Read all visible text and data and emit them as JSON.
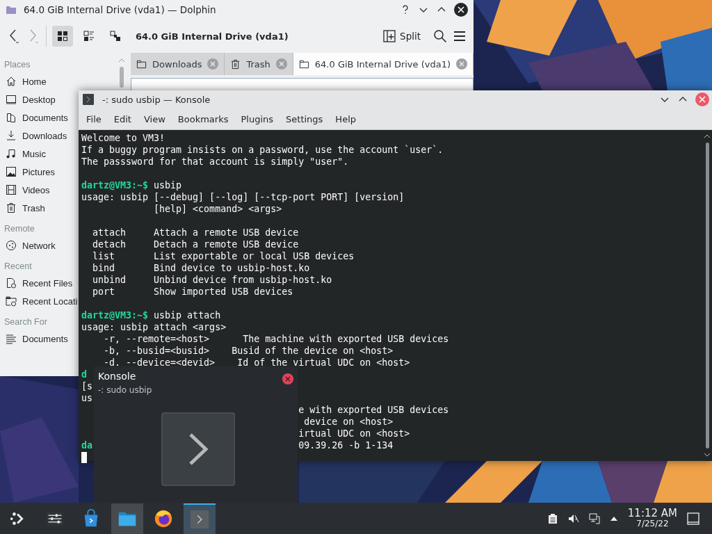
{
  "dolphin": {
    "title": "64.0 GiB Internal Drive (vda1) — Dolphin",
    "location": "64.0 GiB Internal Drive (vda1)",
    "split_label": "Split",
    "tabs": [
      {
        "label": "Downloads",
        "selected": false
      },
      {
        "label": "Trash",
        "selected": false
      },
      {
        "label": "64.0 GiB Internal Drive (vda1)",
        "selected": true
      }
    ],
    "sidebar": [
      {
        "heading": "Places",
        "items": [
          {
            "kind": "home",
            "label": "Home"
          },
          {
            "kind": "desktop",
            "label": "Desktop"
          },
          {
            "kind": "documents",
            "label": "Documents"
          },
          {
            "kind": "downloads",
            "label": "Downloads"
          },
          {
            "kind": "music",
            "label": "Music"
          },
          {
            "kind": "pictures",
            "label": "Pictures"
          },
          {
            "kind": "videos",
            "label": "Videos"
          },
          {
            "kind": "trash",
            "label": "Trash"
          }
        ]
      },
      {
        "heading": "Remote",
        "items": [
          {
            "kind": "network",
            "label": "Network"
          }
        ]
      },
      {
        "heading": "Recent",
        "items": [
          {
            "kind": "recent-files",
            "label": "Recent Files"
          },
          {
            "kind": "recent-locations",
            "label": "Recent Locati"
          }
        ]
      },
      {
        "heading": "Search For",
        "items": [
          {
            "kind": "text",
            "label": "Documents"
          }
        ]
      }
    ]
  },
  "konsole": {
    "title": "-: sudo usbip — Konsole",
    "menu": [
      "File",
      "Edit",
      "View",
      "Bookmarks",
      "Plugins",
      "Settings",
      "Help"
    ],
    "blocks": [
      [
        {
          "segments": [
            {
              "kind": "text",
              "text": "Welcome to VM3!"
            }
          ]
        },
        {
          "segments": [
            {
              "kind": "text",
              "text": "If a buggy program insists on a password, use the account `user`."
            }
          ]
        },
        {
          "segments": [
            {
              "kind": "text",
              "text": "The passsword for that account is simply \"user\"."
            }
          ]
        }
      ],
      [
        {
          "segments": [
            {
              "kind": "prompt",
              "text": "dartz@VM3:~$"
            },
            {
              "kind": "text",
              "text": " usbip"
            }
          ]
        },
        {
          "segments": [
            {
              "kind": "text",
              "text": "usage: usbip [--debug] [--log] [--tcp-port PORT] [version]"
            }
          ]
        },
        {
          "segments": [
            {
              "kind": "text",
              "text": "             [help] <command> <args>"
            }
          ]
        }
      ],
      [
        {
          "segments": [
            {
              "kind": "text",
              "text": "  attach     Attach a remote USB device"
            }
          ]
        },
        {
          "segments": [
            {
              "kind": "text",
              "text": "  detach     Detach a remote USB device"
            }
          ]
        },
        {
          "segments": [
            {
              "kind": "text",
              "text": "  list       List exportable or local USB devices"
            }
          ]
        },
        {
          "segments": [
            {
              "kind": "text",
              "text": "  bind       Bind device to usbip-host.ko"
            }
          ]
        },
        {
          "segments": [
            {
              "kind": "text",
              "text": "  unbind     Unbind device from usbip-host.ko"
            }
          ]
        },
        {
          "segments": [
            {
              "kind": "text",
              "text": "  port       Show imported USB devices"
            }
          ]
        }
      ],
      [
        {
          "segments": [
            {
              "kind": "prompt",
              "text": "dartz@VM3:~$"
            },
            {
              "kind": "text",
              "text": " usbip attach"
            }
          ]
        },
        {
          "segments": [
            {
              "kind": "text",
              "text": "usage: usbip attach <args>"
            }
          ]
        },
        {
          "segments": [
            {
              "kind": "text",
              "text": "    -r, --remote=<host>      The machine with exported USB devices"
            }
          ]
        },
        {
          "segments": [
            {
              "kind": "text",
              "text": "    -b, --busid=<busid>    Busid of the device on <host>"
            }
          ]
        },
        {
          "segments": [
            {
              "kind": "text",
              "text": "    -d. --device=<devid>    Id of the virtual UDC on <host>"
            }
          ]
        },
        {
          "segments": [
            {
              "kind": "prompt",
              "text": "d"
            }
          ]
        },
        {
          "segments": [
            {
              "kind": "text",
              "text": "[s"
            }
          ]
        },
        {
          "segments": [
            {
              "kind": "text",
              "text": "us"
            }
          ]
        },
        {
          "segments": [
            {
              "kind": "text",
              "text": "                                       e with exported USB devices"
            }
          ]
        },
        {
          "segments": [
            {
              "kind": "text",
              "text": "                                        device on <host>"
            }
          ]
        },
        {
          "segments": [
            {
              "kind": "text",
              "text": "                                       irtual UDC on <host>"
            }
          ]
        },
        {
          "segments": [
            {
              "kind": "prompt",
              "text": "da"
            },
            {
              "kind": "text",
              "text": "                                     09.39.26 -b 1-134"
            }
          ]
        },
        {
          "cursor": true
        }
      ]
    ]
  },
  "notification": {
    "title": "Konsole",
    "subtitle": "-: sudo usbip"
  },
  "taskbar": {
    "items": [
      {
        "kind": "launcher",
        "open": false,
        "selected": false
      },
      {
        "kind": "settings",
        "open": false,
        "selected": false
      },
      {
        "kind": "store",
        "open": false,
        "selected": false
      },
      {
        "kind": "files",
        "open": true,
        "selected": false
      },
      {
        "kind": "browser",
        "open": false,
        "selected": false
      },
      {
        "kind": "terminal",
        "open": true,
        "selected": true
      }
    ],
    "time": "11:12 AM",
    "date": "7/25/22"
  }
}
